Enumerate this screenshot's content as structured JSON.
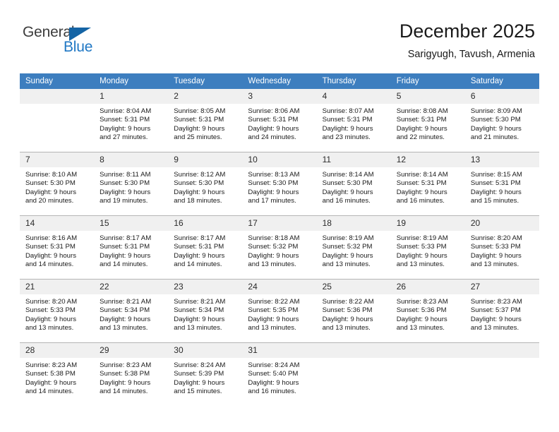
{
  "brand": {
    "name_top": "General",
    "name_bottom": "Blue",
    "accent_color": "#1464a5",
    "blue_text_color": "#1f77c4"
  },
  "header": {
    "title": "December 2025",
    "subtitle": "Sarigyugh, Tavush, Armenia",
    "header_row_color": "#3d7ebf"
  },
  "weekday_headers": [
    "Sunday",
    "Monday",
    "Tuesday",
    "Wednesday",
    "Thursday",
    "Friday",
    "Saturday"
  ],
  "labels": {
    "sunrise_prefix": "Sunrise:",
    "sunset_prefix": "Sunset:",
    "daylight_prefix": "Daylight:"
  },
  "weeks": [
    [
      {
        "day": "",
        "blank": true,
        "sunrise": "",
        "sunset": "",
        "daylight_line1": "",
        "daylight_line2": ""
      },
      {
        "day": "1",
        "sunrise": "Sunrise: 8:04 AM",
        "sunset": "Sunset: 5:31 PM",
        "daylight_line1": "Daylight: 9 hours",
        "daylight_line2": "and 27 minutes."
      },
      {
        "day": "2",
        "sunrise": "Sunrise: 8:05 AM",
        "sunset": "Sunset: 5:31 PM",
        "daylight_line1": "Daylight: 9 hours",
        "daylight_line2": "and 25 minutes."
      },
      {
        "day": "3",
        "sunrise": "Sunrise: 8:06 AM",
        "sunset": "Sunset: 5:31 PM",
        "daylight_line1": "Daylight: 9 hours",
        "daylight_line2": "and 24 minutes."
      },
      {
        "day": "4",
        "sunrise": "Sunrise: 8:07 AM",
        "sunset": "Sunset: 5:31 PM",
        "daylight_line1": "Daylight: 9 hours",
        "daylight_line2": "and 23 minutes."
      },
      {
        "day": "5",
        "sunrise": "Sunrise: 8:08 AM",
        "sunset": "Sunset: 5:31 PM",
        "daylight_line1": "Daylight: 9 hours",
        "daylight_line2": "and 22 minutes."
      },
      {
        "day": "6",
        "sunrise": "Sunrise: 8:09 AM",
        "sunset": "Sunset: 5:30 PM",
        "daylight_line1": "Daylight: 9 hours",
        "daylight_line2": "and 21 minutes."
      }
    ],
    [
      {
        "day": "7",
        "sunrise": "Sunrise: 8:10 AM",
        "sunset": "Sunset: 5:30 PM",
        "daylight_line1": "Daylight: 9 hours",
        "daylight_line2": "and 20 minutes."
      },
      {
        "day": "8",
        "sunrise": "Sunrise: 8:11 AM",
        "sunset": "Sunset: 5:30 PM",
        "daylight_line1": "Daylight: 9 hours",
        "daylight_line2": "and 19 minutes."
      },
      {
        "day": "9",
        "sunrise": "Sunrise: 8:12 AM",
        "sunset": "Sunset: 5:30 PM",
        "daylight_line1": "Daylight: 9 hours",
        "daylight_line2": "and 18 minutes."
      },
      {
        "day": "10",
        "sunrise": "Sunrise: 8:13 AM",
        "sunset": "Sunset: 5:30 PM",
        "daylight_line1": "Daylight: 9 hours",
        "daylight_line2": "and 17 minutes."
      },
      {
        "day": "11",
        "sunrise": "Sunrise: 8:14 AM",
        "sunset": "Sunset: 5:30 PM",
        "daylight_line1": "Daylight: 9 hours",
        "daylight_line2": "and 16 minutes."
      },
      {
        "day": "12",
        "sunrise": "Sunrise: 8:14 AM",
        "sunset": "Sunset: 5:31 PM",
        "daylight_line1": "Daylight: 9 hours",
        "daylight_line2": "and 16 minutes."
      },
      {
        "day": "13",
        "sunrise": "Sunrise: 8:15 AM",
        "sunset": "Sunset: 5:31 PM",
        "daylight_line1": "Daylight: 9 hours",
        "daylight_line2": "and 15 minutes."
      }
    ],
    [
      {
        "day": "14",
        "sunrise": "Sunrise: 8:16 AM",
        "sunset": "Sunset: 5:31 PM",
        "daylight_line1": "Daylight: 9 hours",
        "daylight_line2": "and 14 minutes."
      },
      {
        "day": "15",
        "sunrise": "Sunrise: 8:17 AM",
        "sunset": "Sunset: 5:31 PM",
        "daylight_line1": "Daylight: 9 hours",
        "daylight_line2": "and 14 minutes."
      },
      {
        "day": "16",
        "sunrise": "Sunrise: 8:17 AM",
        "sunset": "Sunset: 5:31 PM",
        "daylight_line1": "Daylight: 9 hours",
        "daylight_line2": "and 14 minutes."
      },
      {
        "day": "17",
        "sunrise": "Sunrise: 8:18 AM",
        "sunset": "Sunset: 5:32 PM",
        "daylight_line1": "Daylight: 9 hours",
        "daylight_line2": "and 13 minutes."
      },
      {
        "day": "18",
        "sunrise": "Sunrise: 8:19 AM",
        "sunset": "Sunset: 5:32 PM",
        "daylight_line1": "Daylight: 9 hours",
        "daylight_line2": "and 13 minutes."
      },
      {
        "day": "19",
        "sunrise": "Sunrise: 8:19 AM",
        "sunset": "Sunset: 5:33 PM",
        "daylight_line1": "Daylight: 9 hours",
        "daylight_line2": "and 13 minutes."
      },
      {
        "day": "20",
        "sunrise": "Sunrise: 8:20 AM",
        "sunset": "Sunset: 5:33 PM",
        "daylight_line1": "Daylight: 9 hours",
        "daylight_line2": "and 13 minutes."
      }
    ],
    [
      {
        "day": "21",
        "sunrise": "Sunrise: 8:20 AM",
        "sunset": "Sunset: 5:33 PM",
        "daylight_line1": "Daylight: 9 hours",
        "daylight_line2": "and 13 minutes."
      },
      {
        "day": "22",
        "sunrise": "Sunrise: 8:21 AM",
        "sunset": "Sunset: 5:34 PM",
        "daylight_line1": "Daylight: 9 hours",
        "daylight_line2": "and 13 minutes."
      },
      {
        "day": "23",
        "sunrise": "Sunrise: 8:21 AM",
        "sunset": "Sunset: 5:34 PM",
        "daylight_line1": "Daylight: 9 hours",
        "daylight_line2": "and 13 minutes."
      },
      {
        "day": "24",
        "sunrise": "Sunrise: 8:22 AM",
        "sunset": "Sunset: 5:35 PM",
        "daylight_line1": "Daylight: 9 hours",
        "daylight_line2": "and 13 minutes."
      },
      {
        "day": "25",
        "sunrise": "Sunrise: 8:22 AM",
        "sunset": "Sunset: 5:36 PM",
        "daylight_line1": "Daylight: 9 hours",
        "daylight_line2": "and 13 minutes."
      },
      {
        "day": "26",
        "sunrise": "Sunrise: 8:23 AM",
        "sunset": "Sunset: 5:36 PM",
        "daylight_line1": "Daylight: 9 hours",
        "daylight_line2": "and 13 minutes."
      },
      {
        "day": "27",
        "sunrise": "Sunrise: 8:23 AM",
        "sunset": "Sunset: 5:37 PM",
        "daylight_line1": "Daylight: 9 hours",
        "daylight_line2": "and 13 minutes."
      }
    ],
    [
      {
        "day": "28",
        "sunrise": "Sunrise: 8:23 AM",
        "sunset": "Sunset: 5:38 PM",
        "daylight_line1": "Daylight: 9 hours",
        "daylight_line2": "and 14 minutes."
      },
      {
        "day": "29",
        "sunrise": "Sunrise: 8:23 AM",
        "sunset": "Sunset: 5:38 PM",
        "daylight_line1": "Daylight: 9 hours",
        "daylight_line2": "and 14 minutes."
      },
      {
        "day": "30",
        "sunrise": "Sunrise: 8:24 AM",
        "sunset": "Sunset: 5:39 PM",
        "daylight_line1": "Daylight: 9 hours",
        "daylight_line2": "and 15 minutes."
      },
      {
        "day": "31",
        "sunrise": "Sunrise: 8:24 AM",
        "sunset": "Sunset: 5:40 PM",
        "daylight_line1": "Daylight: 9 hours",
        "daylight_line2": "and 16 minutes."
      },
      {
        "day": "",
        "blank": true,
        "sunrise": "",
        "sunset": "",
        "daylight_line1": "",
        "daylight_line2": ""
      },
      {
        "day": "",
        "blank": true,
        "sunrise": "",
        "sunset": "",
        "daylight_line1": "",
        "daylight_line2": ""
      },
      {
        "day": "",
        "blank": true,
        "sunrise": "",
        "sunset": "",
        "daylight_line1": "",
        "daylight_line2": ""
      }
    ]
  ]
}
